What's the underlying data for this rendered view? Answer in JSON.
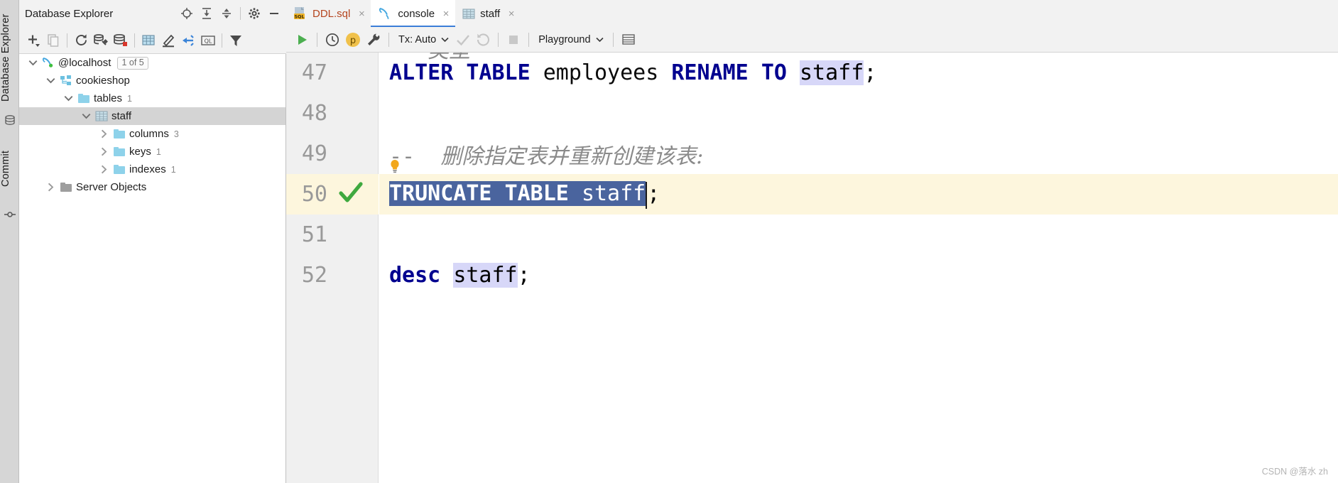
{
  "left_strip": {
    "db_explorer_label": "Database Explorer",
    "commit_label": "Commit",
    "icons": [
      "database-icon",
      "commit-node-icon"
    ]
  },
  "db_panel": {
    "title": "Database Explorer",
    "header_icons": [
      "crosshair-locate-icon",
      "expand-all-icon",
      "collapse-all-icon",
      "gear-icon",
      "minimize-icon"
    ],
    "toolbar_icons": [
      "add-icon",
      "copy-icon",
      "refresh-icon",
      "data-source-properties-icon",
      "modify-datasource-icon",
      "table-editor-icon",
      "edit-icon",
      "jump-to-code-icon",
      "ql-console-icon",
      "filter-icon"
    ],
    "tree": [
      {
        "label": "@localhost",
        "badge": "1 of 5",
        "icon": "mysql-dolphin-icon",
        "indent": 0,
        "twisty": "expanded",
        "selected": false,
        "count": ""
      },
      {
        "label": "cookieshop",
        "badge": "",
        "icon": "schema-icon",
        "indent": 1,
        "twisty": "expanded",
        "selected": false,
        "count": ""
      },
      {
        "label": "tables",
        "badge": "",
        "icon": "folder-icon",
        "indent": 2,
        "twisty": "expanded",
        "selected": false,
        "count": "1"
      },
      {
        "label": "staff",
        "badge": "",
        "icon": "table-icon",
        "indent": 3,
        "twisty": "expanded",
        "selected": true,
        "count": ""
      },
      {
        "label": "columns",
        "badge": "",
        "icon": "folder-icon",
        "indent": 4,
        "twisty": "collapsed",
        "selected": false,
        "count": "3"
      },
      {
        "label": "keys",
        "badge": "",
        "icon": "folder-icon",
        "indent": 4,
        "twisty": "collapsed",
        "selected": false,
        "count": "1"
      },
      {
        "label": "indexes",
        "badge": "",
        "icon": "folder-icon",
        "indent": 4,
        "twisty": "collapsed",
        "selected": false,
        "count": "1"
      },
      {
        "label": "Server Objects",
        "badge": "",
        "icon": "folder-gray-icon",
        "indent": 1,
        "twisty": "collapsed",
        "selected": false,
        "count": ""
      }
    ]
  },
  "editor": {
    "tabs": [
      {
        "label": "DDL.sql",
        "icon": "sql-file-icon",
        "active": false,
        "closable": true
      },
      {
        "label": "console",
        "icon": "mysql-dolphin-icon",
        "active": true,
        "closable": true
      },
      {
        "label": "staff",
        "icon": "table-icon",
        "active": false,
        "closable": true
      }
    ],
    "close_glyph": "×",
    "toolbar": {
      "execute_label": "execute-icon",
      "history_label": "history-icon",
      "profile_label": "p",
      "settings_label": "wrench-icon",
      "tx_label": "Tx: Auto",
      "commit_label": "commit-check-icon",
      "rollback_label": "rollback-icon",
      "stop_label": "stop-icon",
      "schema_label": "Playground",
      "output_label": "output-pane-icon"
    },
    "code": {
      "lines": [
        {
          "num": "47",
          "highlight": false,
          "gutter_icon": "",
          "tokens": [
            {
              "t": "ALTER",
              "c": "kw"
            },
            {
              "t": " ",
              "c": "id"
            },
            {
              "t": "TABLE",
              "c": "kw"
            },
            {
              "t": " ",
              "c": "id"
            },
            {
              "t": "employees",
              "c": "id"
            },
            {
              "t": " ",
              "c": "id"
            },
            {
              "t": "RENAME",
              "c": "kw"
            },
            {
              "t": " ",
              "c": "id"
            },
            {
              "t": "TO",
              "c": "kw"
            },
            {
              "t": " ",
              "c": "id"
            },
            {
              "t": "staff",
              "c": "occur"
            },
            {
              "t": ";",
              "c": "pn"
            }
          ]
        },
        {
          "num": "48",
          "highlight": false,
          "gutter_icon": "",
          "tokens": []
        },
        {
          "num": "49",
          "highlight": false,
          "gutter_icon": "",
          "tokens": [
            {
              "t": "--",
              "c": "cmtdash"
            },
            {
              "t": "  ",
              "c": "cmtdash"
            },
            {
              "t": "删除指定表并重新创建该表:",
              "c": "cmt"
            }
          ]
        },
        {
          "num": "50",
          "highlight": true,
          "gutter_icon": "green-check-icon",
          "tokens": [
            {
              "t": "TRUNCATE TABLE staff",
              "c": "sel"
            },
            {
              "t": ";",
              "c": "pn"
            }
          ]
        },
        {
          "num": "51",
          "highlight": false,
          "gutter_icon": "",
          "tokens": []
        },
        {
          "num": "52",
          "highlight": false,
          "gutter_icon": "",
          "tokens": [
            {
              "t": "desc",
              "c": "kw"
            },
            {
              "t": " ",
              "c": "id"
            },
            {
              "t": "staff",
              "c": "occur"
            },
            {
              "t": ";",
              "c": "pn"
            }
          ]
        }
      ],
      "selected_text": "TRUNCATE TABLE staff",
      "intention_bulb": "lightbulb-icon",
      "clipped_top_fragment": "--  类型"
    }
  },
  "watermark": "CSDN @落水 zh",
  "colors": {
    "keyword": "#00008f",
    "selection_bg": "#4a649e",
    "line_highlight": "#fdf6dd",
    "occurrence_bg": "#d7d7f8",
    "accent_blue": "#3b7dd8",
    "folder_blue": "#8ed2ea",
    "run_green": "#4caf50",
    "tab_active_underline": "#3b7dd8",
    "tree_selected_bg": "#d4d4d4"
  }
}
